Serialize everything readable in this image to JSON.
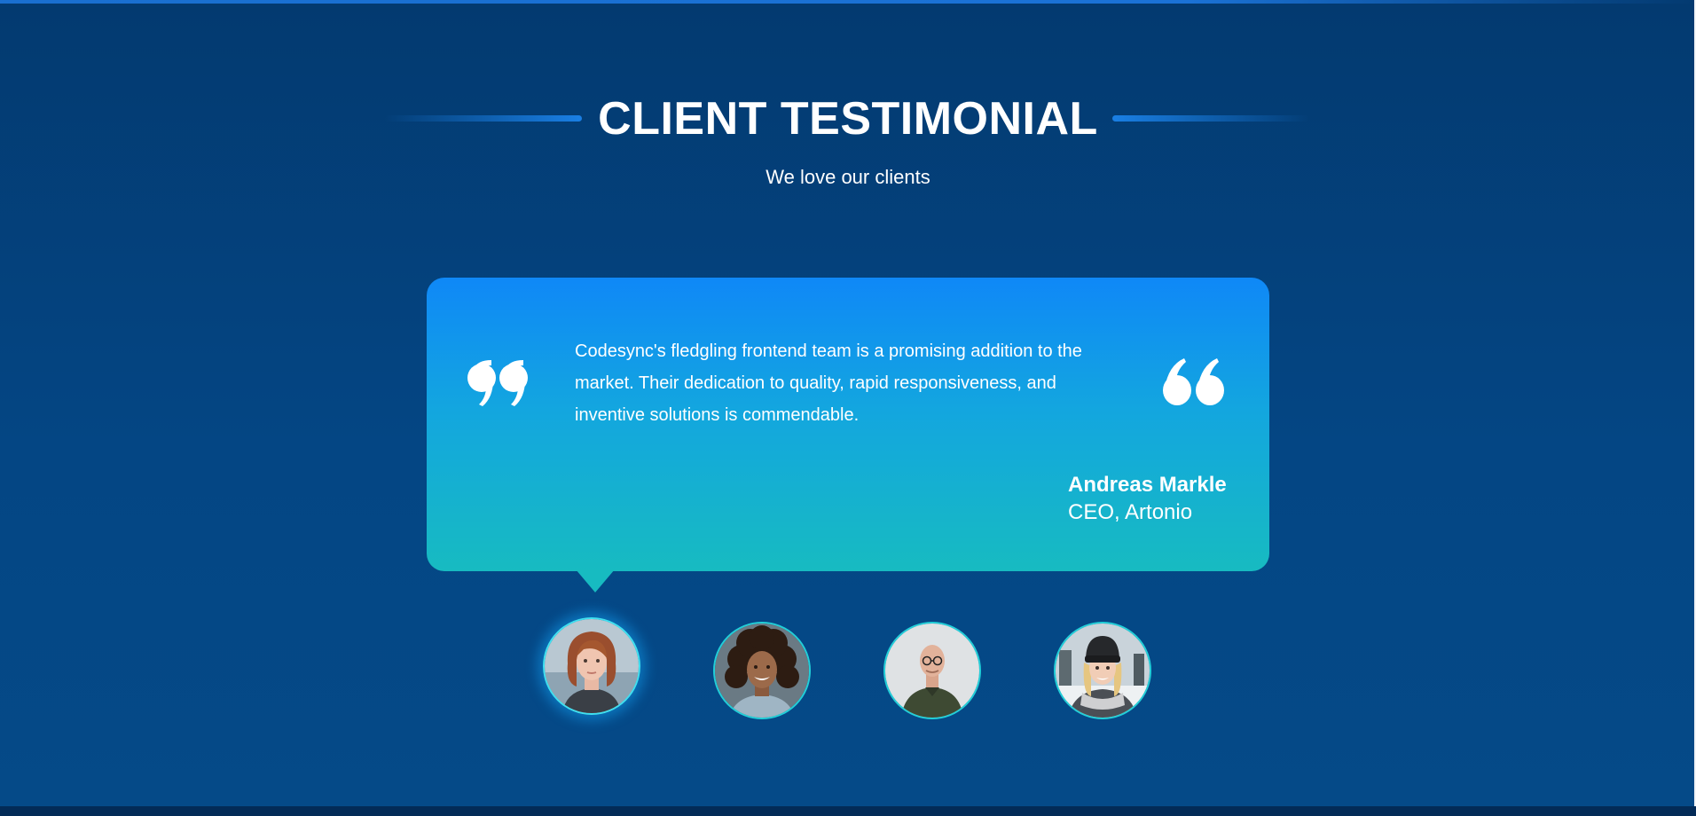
{
  "header": {
    "title": "CLIENT TESTIMONIAL",
    "subtitle": "We love our clients"
  },
  "testimonial": {
    "quote": "Codesync's fledgling frontend team is a promising addition to the market. Their dedication to quality, rapid responsiveness, and inventive solutions is commendable.",
    "author_name": "Andreas Markle",
    "author_role": "CEO, Artonio"
  },
  "avatars": [
    {
      "icon": "avatar-woman-bob-hair",
      "active": true
    },
    {
      "icon": "avatar-woman-curly-hair",
      "active": false
    },
    {
      "icon": "avatar-bald-man-glasses",
      "active": false
    },
    {
      "icon": "avatar-woman-beanie",
      "active": false
    }
  ],
  "colors": {
    "background": "#044684",
    "card_top": "#0f88f7",
    "card_bottom": "#17bbc1",
    "accent_line": "#1a7fe4",
    "avatar_border": "#22cfd8"
  }
}
